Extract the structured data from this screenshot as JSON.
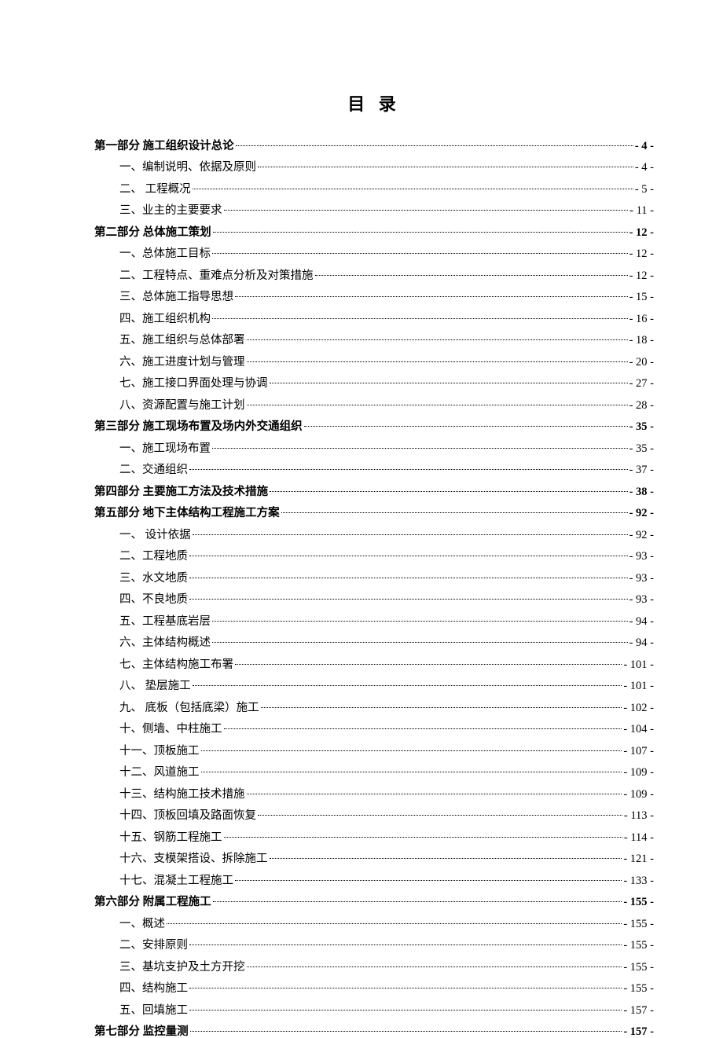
{
  "title": "目 录",
  "entries": [
    {
      "level": 0,
      "label": "第一部分 施工组织设计总论",
      "page": "- 4 -"
    },
    {
      "level": 1,
      "label": "一、编制说明、依据及原则",
      "page": "- 4 -"
    },
    {
      "level": 1,
      "label": "二、 工程概况",
      "page": "- 5 -"
    },
    {
      "level": 1,
      "label": "三、业主的主要要求",
      "page": "- 11 -"
    },
    {
      "level": 0,
      "label": "第二部分  总体施工策划",
      "page": "- 12 -"
    },
    {
      "level": 1,
      "label": "一、总体施工目标",
      "page": "- 12 -"
    },
    {
      "level": 1,
      "label": "二、工程特点、重难点分析及对策措施",
      "page": "- 12 -"
    },
    {
      "level": 1,
      "label": "三、总体施工指导思想",
      "page": "- 15 -"
    },
    {
      "level": 1,
      "label": "四、施工组织机构",
      "page": "- 16 -"
    },
    {
      "level": 1,
      "label": "五、施工组织与总体部署",
      "page": "- 18 -"
    },
    {
      "level": 1,
      "label": "六、施工进度计划与管理",
      "page": "- 20 -"
    },
    {
      "level": 1,
      "label": "七、施工接口界面处理与协调",
      "page": "- 27 -"
    },
    {
      "level": 1,
      "label": "八、资源配置与施工计划",
      "page": "- 28 -"
    },
    {
      "level": 0,
      "label": "第三部分 施工现场布置及场内外交通组织",
      "page": "- 35 -"
    },
    {
      "level": 1,
      "label": "一、施工现场布置",
      "page": "- 35 -"
    },
    {
      "level": 1,
      "label": "二、交通组织",
      "page": "- 37 -"
    },
    {
      "level": 0,
      "label": "第四部分  主要施工方法及技术措施",
      "page": "- 38 -"
    },
    {
      "level": 0,
      "label": "第五部分  地下主体结构工程施工方案",
      "page": "- 92 -"
    },
    {
      "level": 1,
      "label": "一、 设计依据",
      "page": "- 92 -"
    },
    {
      "level": 1,
      "label": "二、工程地质",
      "page": "- 93 -"
    },
    {
      "level": 1,
      "label": "三、水文地质",
      "page": "- 93 -"
    },
    {
      "level": 1,
      "label": "四、不良地质",
      "page": "- 93 -"
    },
    {
      "level": 1,
      "label": "五、工程基底岩层",
      "page": "- 94 -"
    },
    {
      "level": 1,
      "label": "六、主体结构概述",
      "page": "- 94 -"
    },
    {
      "level": 1,
      "label": "七、主体结构施工布署",
      "page": "- 101 -"
    },
    {
      "level": 1,
      "label": "八、 垫层施工",
      "page": "- 101 -"
    },
    {
      "level": 1,
      "label": "九、 底板（包括底梁）施工",
      "page": "- 102 -"
    },
    {
      "level": 1,
      "label": "十、侧墙、中柱施工",
      "page": "- 104 -"
    },
    {
      "level": 1,
      "label": "十一、顶板施工",
      "page": "- 107 -"
    },
    {
      "level": 1,
      "label": "十二、风道施工",
      "page": "- 109 -"
    },
    {
      "level": 1,
      "label": "十三、结构施工技术措施",
      "page": "- 109 -"
    },
    {
      "level": 1,
      "label": "十四、顶板回填及路面恢复",
      "page": "- 113 -"
    },
    {
      "level": 1,
      "label": "十五、钢筋工程施工",
      "page": "- 114 -"
    },
    {
      "level": 1,
      "label": "十六、支模架搭设、拆除施工",
      "page": "- 121 -"
    },
    {
      "level": 1,
      "label": "十七、混凝土工程施工",
      "page": "- 133 -"
    },
    {
      "level": 0,
      "label": "第六部分   附属工程施工",
      "page": "- 155 -"
    },
    {
      "level": 1,
      "label": "一、概述",
      "page": "- 155 -"
    },
    {
      "level": 1,
      "label": "二、安排原则",
      "page": "- 155 -"
    },
    {
      "level": 1,
      "label": "三、基坑支护及土方开挖",
      "page": "- 155 -"
    },
    {
      "level": 1,
      "label": "四、结构施工",
      "page": "- 155 -"
    },
    {
      "level": 1,
      "label": "五、回填施工",
      "page": "- 157 -"
    },
    {
      "level": 0,
      "label": "第七部分  监控量测",
      "page": "- 157 -"
    }
  ]
}
